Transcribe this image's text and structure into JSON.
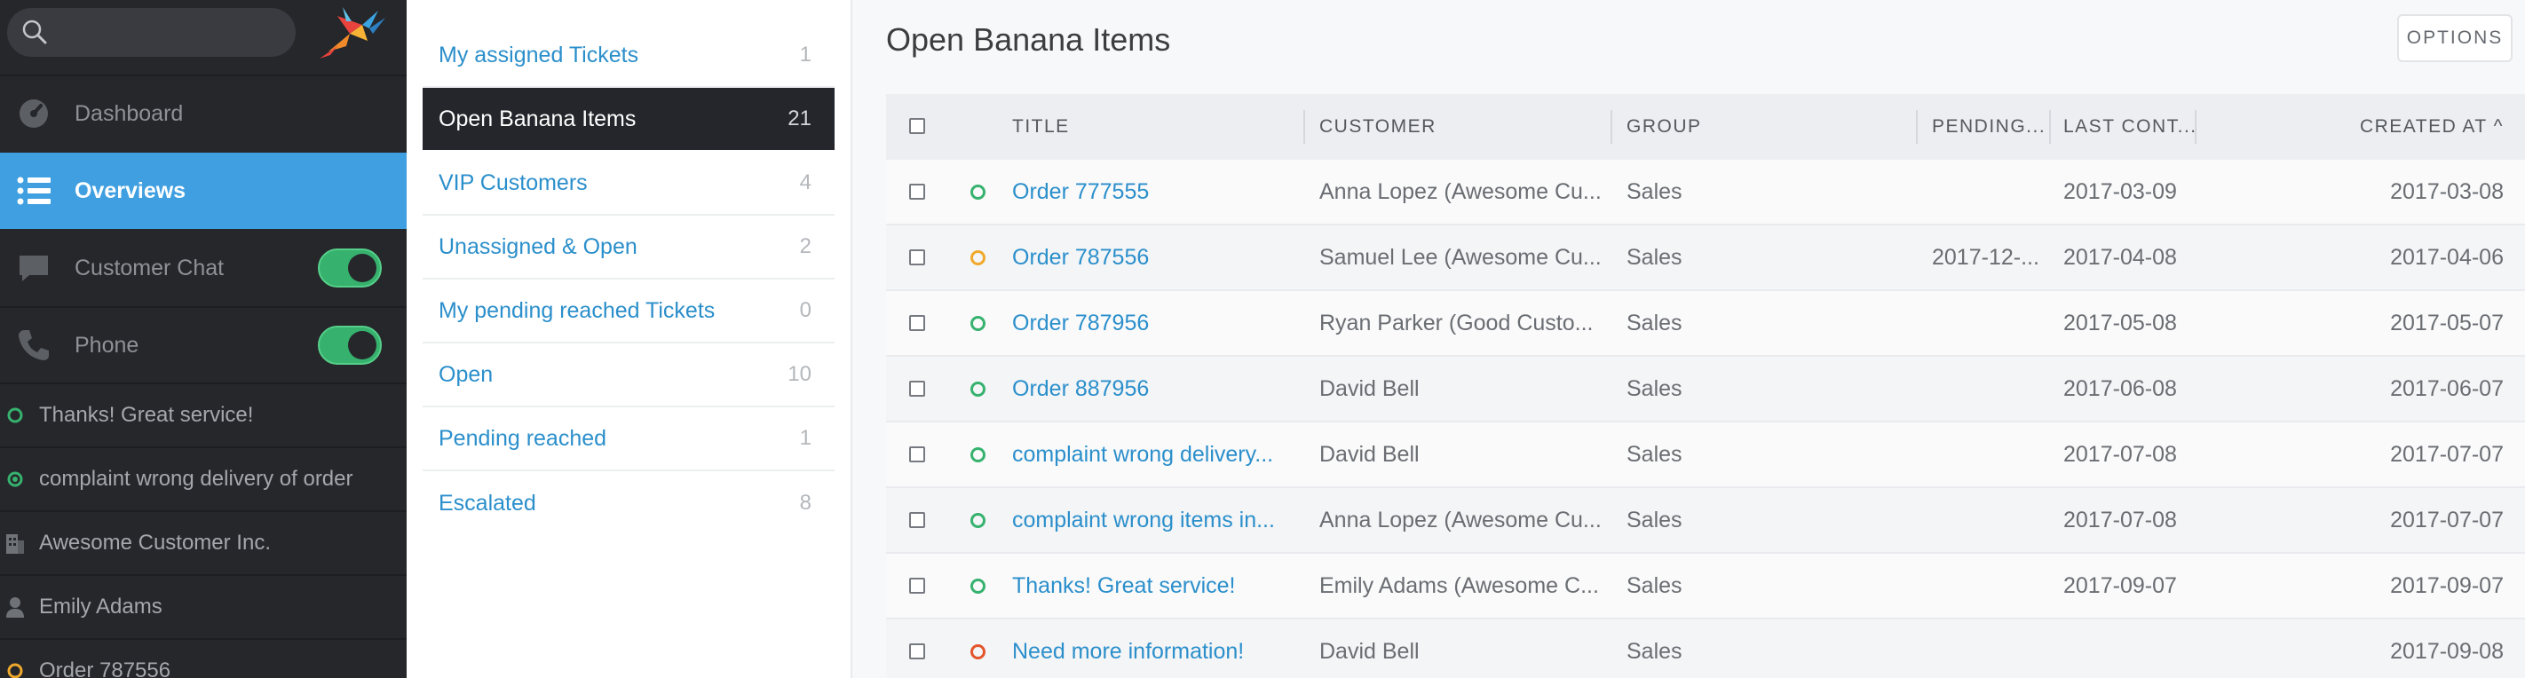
{
  "nav": {
    "items": [
      {
        "label": "Dashboard",
        "icon": "dashboard-icon"
      },
      {
        "label": "Overviews",
        "icon": "list-icon",
        "active": true
      },
      {
        "label": "Customer Chat",
        "icon": "chat-icon",
        "toggle": true
      },
      {
        "label": "Phone",
        "icon": "phone-icon",
        "toggle": true
      }
    ],
    "recent": [
      {
        "label": "Thanks! Great service!",
        "icon": "ticket-open-icon",
        "color": "#36b26e"
      },
      {
        "label": "complaint wrong delivery of order",
        "icon": "ticket-open-icon",
        "color": "#36b26e"
      },
      {
        "label": "Awesome Customer Inc.",
        "icon": "building-icon",
        "color": "#6f7277"
      },
      {
        "label": "Emily Adams",
        "icon": "person-icon",
        "color": "#6f7277"
      },
      {
        "label": "Order 787556",
        "icon": "ticket-pending-icon",
        "color": "#f0a92c"
      }
    ]
  },
  "overviews": [
    {
      "label": "My assigned Tickets",
      "count": "1"
    },
    {
      "label": "Open Banana Items",
      "count": "21",
      "active": true
    },
    {
      "label": "VIP Customers",
      "count": "4"
    },
    {
      "label": "Unassigned & Open",
      "count": "2"
    },
    {
      "label": "My pending reached Tickets",
      "count": "0"
    },
    {
      "label": "Open",
      "count": "10"
    },
    {
      "label": "Pending reached",
      "count": "1"
    },
    {
      "label": "Escalated",
      "count": "8"
    }
  ],
  "main": {
    "title": "Open Banana Items",
    "options_label": "OPTIONS",
    "columns": {
      "title": "TITLE",
      "customer": "CUSTOMER",
      "group": "GROUP",
      "pending": "PENDING...",
      "last_contact": "LAST CONT...",
      "created_at": "CREATED AT ^"
    },
    "rows": [
      {
        "status": "open",
        "status_color": "#36b26e",
        "title": "Order 777555",
        "customer": "Anna Lopez (Awesome Cu...",
        "group": "Sales",
        "pending": "",
        "last_contact": "2017-03-09",
        "created_at": "2017-03-08"
      },
      {
        "status": "pending",
        "status_color": "#f0a92c",
        "title": "Order 787556",
        "customer": "Samuel Lee (Awesome Cu...",
        "group": "Sales",
        "pending": "2017-12-...",
        "last_contact": "2017-04-08",
        "created_at": "2017-04-06"
      },
      {
        "status": "open",
        "status_color": "#36b26e",
        "title": "Order 787956",
        "customer": "Ryan Parker (Good Custo...",
        "group": "Sales",
        "pending": "",
        "last_contact": "2017-05-08",
        "created_at": "2017-05-07"
      },
      {
        "status": "open",
        "status_color": "#36b26e",
        "title": "Order 887956",
        "customer": "David Bell",
        "group": "Sales",
        "pending": "",
        "last_contact": "2017-06-08",
        "created_at": "2017-06-07"
      },
      {
        "status": "open",
        "status_color": "#36b26e",
        "title": "complaint wrong delivery...",
        "customer": "David Bell",
        "group": "Sales",
        "pending": "",
        "last_contact": "2017-07-08",
        "created_at": "2017-07-07"
      },
      {
        "status": "open",
        "status_color": "#36b26e",
        "title": "complaint wrong items in...",
        "customer": "Anna Lopez (Awesome Cu...",
        "group": "Sales",
        "pending": "",
        "last_contact": "2017-07-08",
        "created_at": "2017-07-07"
      },
      {
        "status": "open",
        "status_color": "#36b26e",
        "title": "Thanks! Great service!",
        "customer": "Emily Adams (Awesome C...",
        "group": "Sales",
        "pending": "",
        "last_contact": "2017-09-07",
        "created_at": "2017-09-07"
      },
      {
        "status": "escalated",
        "status_color": "#e3552a",
        "title": "Need more information!",
        "customer": "David Bell",
        "group": "Sales",
        "pending": "",
        "last_contact": "",
        "created_at": "2017-09-08"
      }
    ]
  }
}
